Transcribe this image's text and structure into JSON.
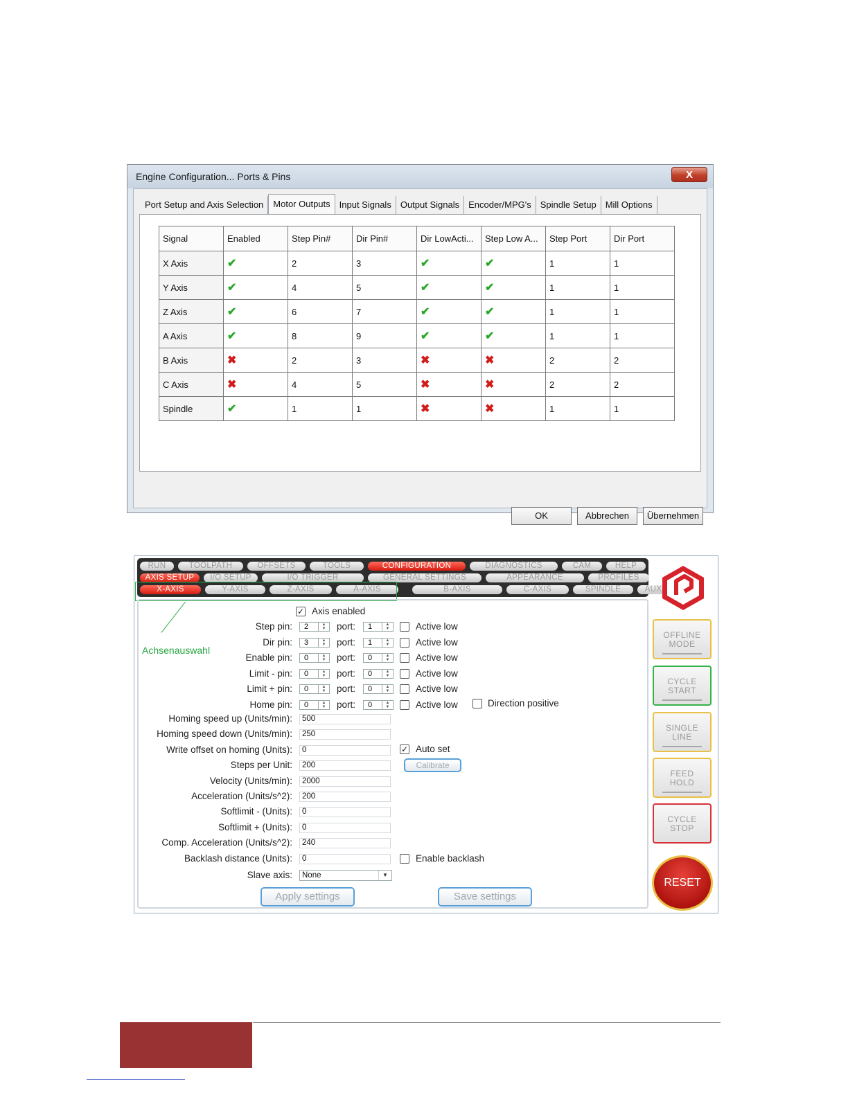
{
  "mach3": {
    "title": "Engine Configuration... Ports & Pins",
    "close": "X",
    "tabs": [
      "Port Setup and Axis Selection",
      "Motor Outputs",
      "Input Signals",
      "Output Signals",
      "Encoder/MPG's",
      "Spindle Setup",
      "Mill Options"
    ],
    "active_tab": "Motor Outputs",
    "columns": [
      "Signal",
      "Enabled",
      "Step Pin#",
      "Dir Pin#",
      "Dir LowActi...",
      "Step Low A...",
      "Step Port",
      "Dir Port"
    ],
    "rows": [
      {
        "signal": "X Axis",
        "enabled": true,
        "step_pin": "2",
        "dir_pin": "3",
        "dir_low": true,
        "step_low": true,
        "step_port": "1",
        "dir_port": "1"
      },
      {
        "signal": "Y Axis",
        "enabled": true,
        "step_pin": "4",
        "dir_pin": "5",
        "dir_low": true,
        "step_low": true,
        "step_port": "1",
        "dir_port": "1"
      },
      {
        "signal": "Z Axis",
        "enabled": true,
        "step_pin": "6",
        "dir_pin": "7",
        "dir_low": true,
        "step_low": true,
        "step_port": "1",
        "dir_port": "1"
      },
      {
        "signal": "A Axis",
        "enabled": true,
        "step_pin": "8",
        "dir_pin": "9",
        "dir_low": true,
        "step_low": true,
        "step_port": "1",
        "dir_port": "1"
      },
      {
        "signal": "B Axis",
        "enabled": false,
        "step_pin": "2",
        "dir_pin": "3",
        "dir_low": false,
        "step_low": false,
        "step_port": "2",
        "dir_port": "2"
      },
      {
        "signal": "C Axis",
        "enabled": false,
        "step_pin": "4",
        "dir_pin": "5",
        "dir_low": false,
        "step_low": false,
        "step_port": "2",
        "dir_port": "2"
      },
      {
        "signal": "Spindle",
        "enabled": true,
        "step_pin": "1",
        "dir_pin": "1",
        "dir_low": false,
        "step_low": false,
        "step_port": "1",
        "dir_port": "1"
      }
    ],
    "buttons": {
      "ok": "OK",
      "cancel": "Abbrechen",
      "apply": "Übernehmen"
    },
    "icons": {
      "enabled": "checkmark-icon",
      "disabled": "cross-icon"
    },
    "colors": {
      "check": "#2aa72a",
      "cross": "#d21c1c"
    }
  },
  "mach4": {
    "tabs_row1": [
      {
        "label": "RUN",
        "active": false
      },
      {
        "label": "TOOLPATH",
        "active": false
      },
      {
        "label": "OFFSETS",
        "active": false
      },
      {
        "label": "TOOLS",
        "active": false
      },
      {
        "label": "CONFIGURATION",
        "active": true
      },
      {
        "label": "DIAGNOSTICS",
        "active": false
      },
      {
        "label": "CAM",
        "active": false
      },
      {
        "label": "HELP",
        "active": false
      }
    ],
    "tabs_row2": [
      {
        "label": "AXIS SETUP",
        "active": true
      },
      {
        "label": "I/O SETUP",
        "active": false
      },
      {
        "label": "I/O  TRIGGER",
        "active": false
      },
      {
        "label": "GENERAL SETTINGS",
        "active": false
      },
      {
        "label": "APPEARANCE",
        "active": false
      },
      {
        "label": "PROFILES",
        "active": false
      }
    ],
    "tabs_row3": [
      {
        "label": "X-AXIS",
        "active": true
      },
      {
        "label": "Y-AXIS",
        "active": false
      },
      {
        "label": "Z-AXIS",
        "active": false
      },
      {
        "label": "A-AXIS",
        "active": false
      },
      {
        "label": "B-AXIS",
        "active": false
      },
      {
        "label": "C-AXIS",
        "active": false
      },
      {
        "label": "SPINDLE",
        "active": false
      },
      {
        "label": "AUX ENC.",
        "active": false
      }
    ],
    "annotation": "Achsenauswahl",
    "axis_enabled": {
      "label": "Axis enabled",
      "checked": true
    },
    "pin_rows": [
      {
        "label": "Step pin:",
        "pin": "2",
        "port_label": "port:",
        "port": "1",
        "active_low": "Active low"
      },
      {
        "label": "Dir pin:",
        "pin": "3",
        "port_label": "port:",
        "port": "1",
        "active_low": "Active low"
      },
      {
        "label": "Enable pin:",
        "pin": "0",
        "port_label": "port:",
        "port": "0",
        "active_low": "Active low"
      },
      {
        "label": "Limit - pin:",
        "pin": "0",
        "port_label": "port:",
        "port": "0",
        "active_low": "Active low"
      },
      {
        "label": "Limit + pin:",
        "pin": "0",
        "port_label": "port:",
        "port": "0",
        "active_low": "Active low"
      },
      {
        "label": "Home pin:",
        "pin": "0",
        "port_label": "port:",
        "port": "0",
        "active_low": "Active low"
      }
    ],
    "direction_positive": "Direction positive",
    "fields": [
      {
        "label": "Homing speed up (Units/min):",
        "value": "500"
      },
      {
        "label": "Homing speed down (Units/min):",
        "value": "250"
      },
      {
        "label": "Write offset on homing (Units):",
        "value": "0"
      },
      {
        "label": "Steps per Unit:",
        "value": "200"
      },
      {
        "label": "Velocity (Units/min):",
        "value": "2000"
      },
      {
        "label": "Acceleration (Units/s^2):",
        "value": "200"
      },
      {
        "label": "Softlimit - (Units):",
        "value": "0"
      },
      {
        "label": "Softlimit + (Units):",
        "value": "0"
      },
      {
        "label": "Comp. Acceleration (Units/s^2):",
        "value": "240"
      },
      {
        "label": "Backlash distance (Units):",
        "value": "0"
      }
    ],
    "auto_set": {
      "label": "Auto set",
      "checked": true
    },
    "calibrate": "Calibrate",
    "enable_backlash": "Enable backlash",
    "slave_axis": {
      "label": "Slave axis:",
      "value": "None"
    },
    "apply_settings": "Apply settings",
    "save_settings": "Save settings",
    "side_buttons": [
      "OFFLINE\nMODE",
      "CYCLE\nSTART",
      "SINGLE\nLINE",
      "FEED\nHOLD",
      "CYCLE\nSTOP"
    ],
    "reset": "RESET",
    "colors": {
      "active_tab": "#e0281c",
      "annotation": "#26a641",
      "logo": "#d6222a",
      "reset": "#c0180f"
    }
  }
}
